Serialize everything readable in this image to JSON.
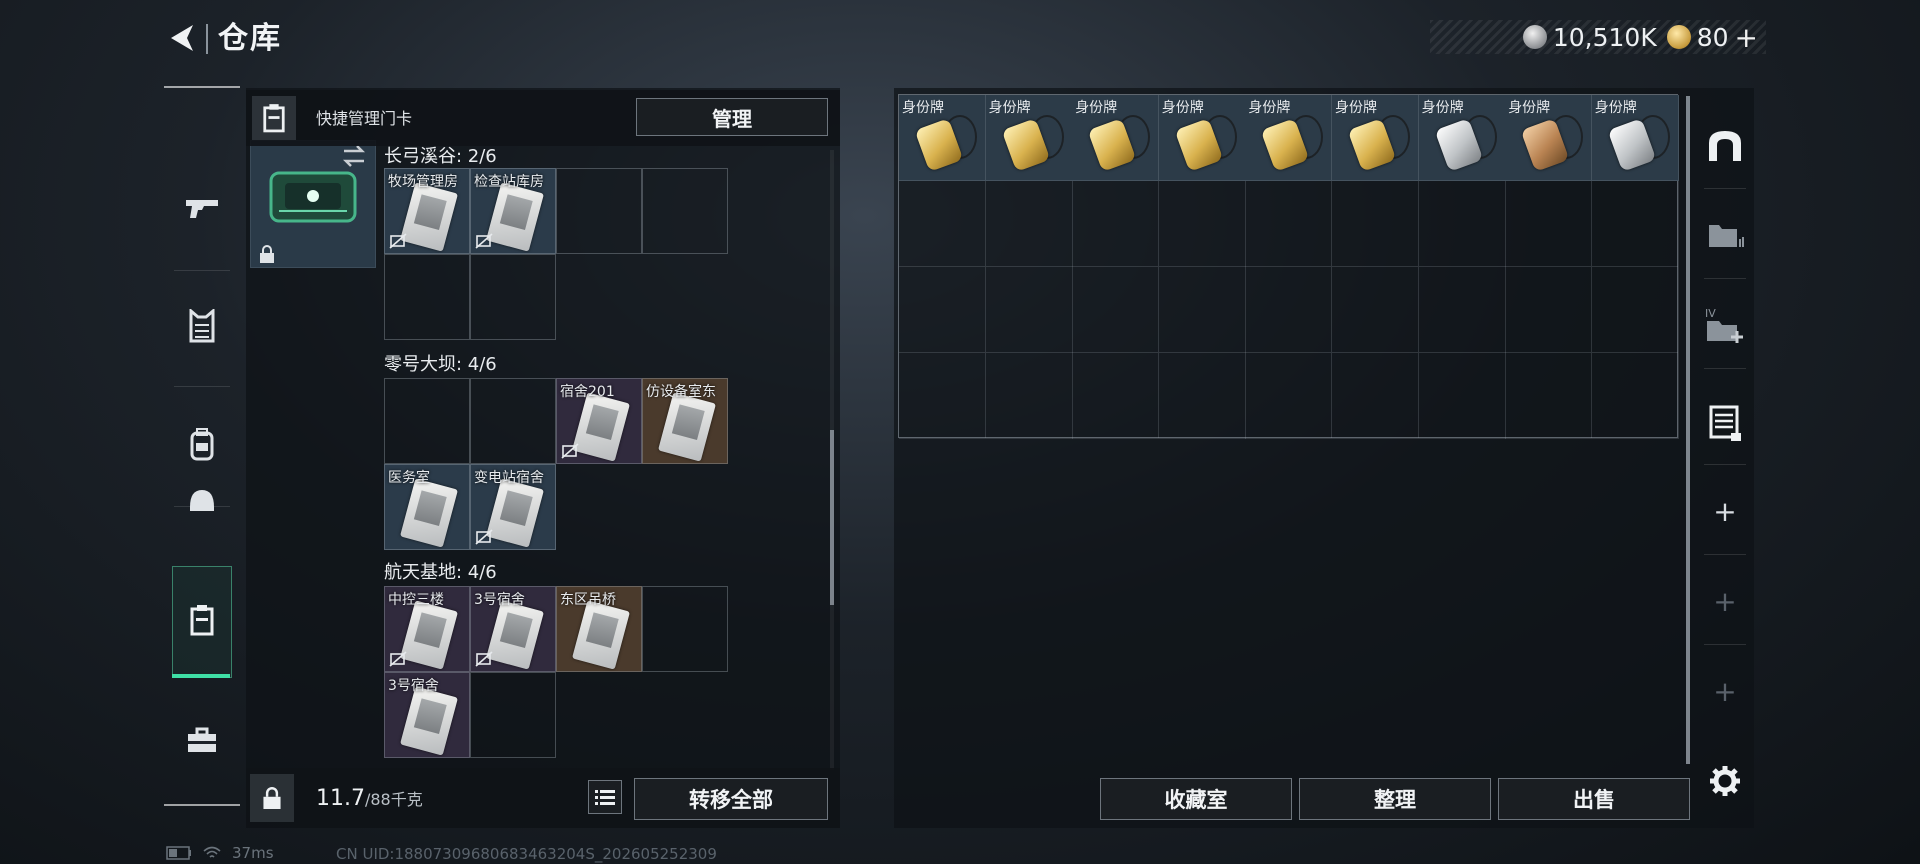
{
  "header": {
    "title": "仓库",
    "currency": {
      "primary": "10,510K",
      "secondary": "80"
    }
  },
  "quick_bar": {
    "label": "快捷管理门卡",
    "manage_label": "管理"
  },
  "sections": [
    {
      "title": "长弓溪谷: 2/6",
      "cards": [
        "牧场管理房",
        "检查站库房"
      ]
    },
    {
      "title": "零号大坝: 4/6",
      "cards": [
        "宿舍201",
        "仿设备室东",
        "医务室",
        "变电站宿舍"
      ]
    },
    {
      "title": "航天基地: 4/6",
      "cards": [
        "中控三楼",
        "3号宿舍",
        "东区吊桥",
        "3号宿舍"
      ]
    }
  ],
  "weight": {
    "current": "11.7",
    "max": "/88千克"
  },
  "left_bottom": {
    "transfer_all": "转移全部"
  },
  "stash": {
    "dogtag_label": "身份牌",
    "dogtags": [
      {
        "label": "身份牌",
        "tier": "gold"
      },
      {
        "label": "身份牌",
        "tier": "gold"
      },
      {
        "label": "身份牌",
        "tier": "gold"
      },
      {
        "label": "身份牌",
        "tier": "gold"
      },
      {
        "label": "身份牌",
        "tier": "gold"
      },
      {
        "label": "身份牌",
        "tier": "gold"
      },
      {
        "label": "身份牌",
        "tier": "silver"
      },
      {
        "label": "身份牌",
        "tier": "bronze"
      },
      {
        "label": "身份牌",
        "tier": "silver"
      }
    ]
  },
  "right_bottom": {
    "collection": "收藏室",
    "sort": "整理",
    "sell": "出售"
  },
  "status": {
    "ping": "37ms",
    "uid": "CN UID:18807309680683463204S_202605252309"
  },
  "colors": {
    "accent_green": "#3fe0a6",
    "card_blue": "#2b3b4a",
    "card_purple": "#302a3d",
    "card_orange": "#4a3a2c"
  }
}
